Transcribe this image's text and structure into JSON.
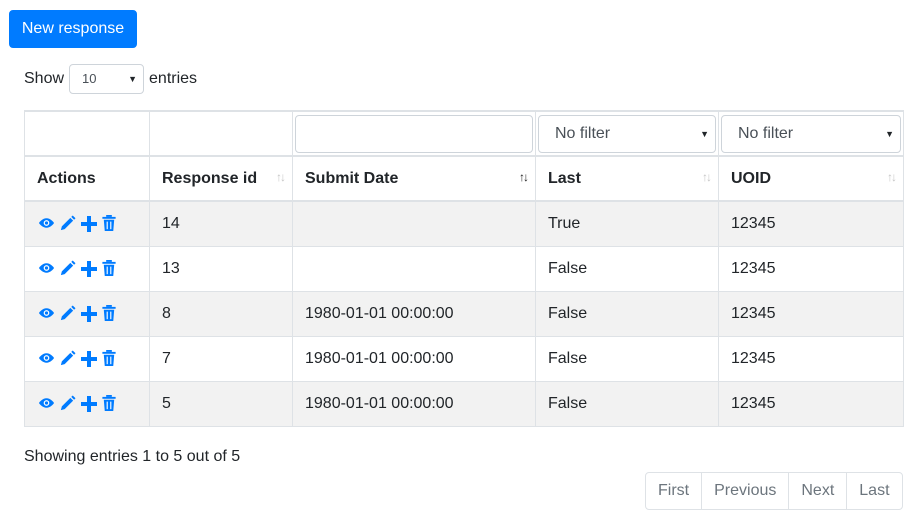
{
  "toolbar": {
    "new_label": "New response"
  },
  "length": {
    "prefix": "Show",
    "value": "10",
    "suffix": "entries"
  },
  "filters": {
    "submit_placeholder": "",
    "last_value": "No filter",
    "uoid_value": "No filter"
  },
  "columns": [
    {
      "label": "Actions"
    },
    {
      "label": "Response id",
      "sort": "both"
    },
    {
      "label": "Submit Date",
      "sort": "active"
    },
    {
      "label": "Last",
      "sort": "both"
    },
    {
      "label": "UOID",
      "sort": "both"
    }
  ],
  "sort_glyphs": {
    "both": "↑↓",
    "active": "↑↓"
  },
  "rows": [
    {
      "id": "14",
      "submit": "",
      "last": "True",
      "uoid": "12345"
    },
    {
      "id": "13",
      "submit": "",
      "last": "False",
      "uoid": "12345"
    },
    {
      "id": "8",
      "submit": "1980-01-01 00:00:00",
      "last": "False",
      "uoid": "12345"
    },
    {
      "id": "7",
      "submit": "1980-01-01 00:00:00",
      "last": "False",
      "uoid": "12345"
    },
    {
      "id": "5",
      "submit": "1980-01-01 00:00:00",
      "last": "False",
      "uoid": "12345"
    }
  ],
  "info": "Showing entries 1 to 5 out of 5",
  "pager": {
    "first": "First",
    "previous": "Previous",
    "next": "Next",
    "last": "Last"
  },
  "colors": {
    "accent": "#007bff",
    "stripe": "#f2f2f2",
    "border": "#dee2e6"
  }
}
